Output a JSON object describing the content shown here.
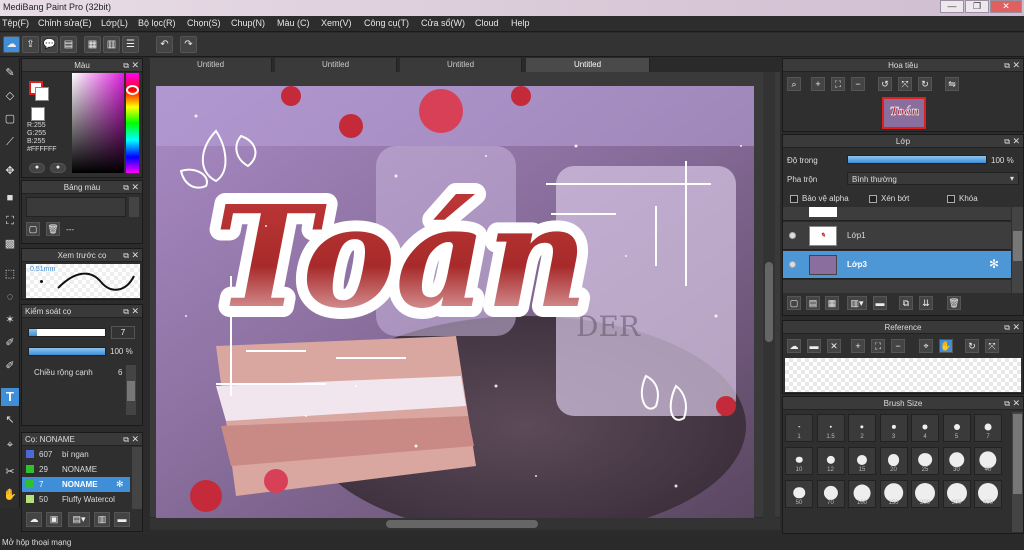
{
  "window": {
    "title": "MediBang Paint Pro (32bit)",
    "minimize": "—",
    "restore": "❐",
    "close": "✕"
  },
  "menu": [
    "Tệp(F)",
    "Chỉnh sửa(E)",
    "Lớp(L)",
    "Bộ lọc(R)",
    "Chọn(S)",
    "Chup(N)",
    "Màu (C)",
    "Xem(V)",
    "Công cụ(T)",
    "Cửa sổ(W)",
    "Cloud",
    "Help"
  ],
  "tabs": [
    "Untitled",
    "Untitled",
    "Untitled",
    "Untitled"
  ],
  "color_panel": {
    "title": "Màu",
    "r": "R:255",
    "g": "G:255",
    "b": "B:255",
    "hex": "#FFFFFF"
  },
  "palette_panel": {
    "title": "Bảng màu",
    "none": "---"
  },
  "preview_panel": {
    "title": "Xem trước cọ",
    "size": "0.51mm"
  },
  "brush_control": {
    "title": "Kiểm soát cọ",
    "size_value": "7",
    "opacity_value": "100 %",
    "opacity_fraction": 1.0,
    "width_label": "Chiều rộng cạnh",
    "width_value": "6"
  },
  "brush_list": {
    "title": "Cọ: NONAME",
    "items": [
      {
        "num": "607",
        "name": "bí ngan",
        "color": "#4a6ad8"
      },
      {
        "num": "29",
        "name": "NONAME",
        "color": "#2ec12e"
      },
      {
        "num": "7",
        "name": "NONAME",
        "color": "#2ec12e"
      },
      {
        "num": "50",
        "name": "Fluffy Watercol",
        "color": "#b8e07a"
      }
    ]
  },
  "navigator": {
    "title": "Hoa tiêu"
  },
  "layer_panel": {
    "title": "Lớp",
    "opacity_label": "Độ trong",
    "opacity_value": "100 %",
    "opacity_fraction": 1.0,
    "blend_label": "Pha trộn",
    "blend_value": "Bình thường",
    "protect_alpha": "Bảo vệ alpha",
    "clipping": "Xén bớt",
    "lock": "Khóa",
    "layers": [
      {
        "name": "Lớp1"
      },
      {
        "name": "Lớp3"
      }
    ]
  },
  "reference_panel": {
    "title": "Reference"
  },
  "brush_size_panel": {
    "title": "Brush Size",
    "sizes": [
      "1",
      "1.5",
      "2",
      "3",
      "4",
      "5",
      "7",
      "10",
      "12",
      "15",
      "20",
      "25",
      "30",
      "40",
      "50",
      "70",
      "100",
      "150",
      "200",
      "300",
      "400"
    ]
  },
  "artwork": {
    "word": "Toán"
  },
  "status": {
    "text": "Mở hộp thoại mạng"
  },
  "colors": {
    "accent": "#3f8ed8",
    "title_red": "#b72e2e"
  }
}
